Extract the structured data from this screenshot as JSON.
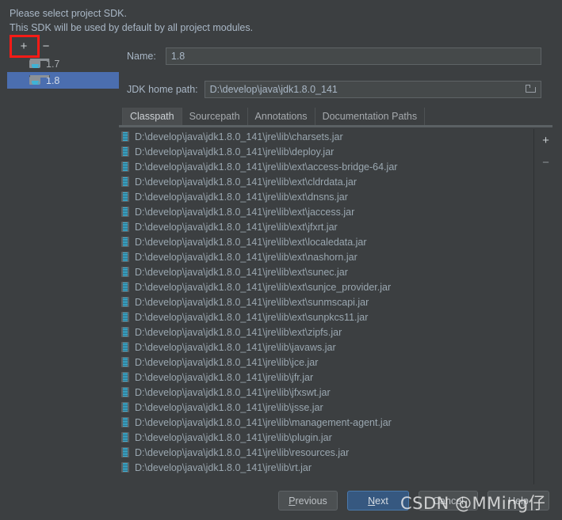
{
  "dialog": {
    "prompt_line1": "Please select project SDK.",
    "prompt_line2": "This SDK will be used by default by all project modules."
  },
  "sdk_panel": {
    "add_label": "+",
    "remove_label": "−",
    "items": [
      {
        "label": "1.7",
        "selected": false
      },
      {
        "label": "1.8",
        "selected": true
      }
    ]
  },
  "detail": {
    "name_label": "Name:",
    "name_value": "1.8",
    "path_label": "JDK home path:",
    "path_value": "D:\\develop\\java\\jdk1.8.0_141",
    "browse_icon": "folder-browse-icon"
  },
  "tabs": [
    {
      "label": "Classpath",
      "active": true
    },
    {
      "label": "Sourcepath",
      "active": false
    },
    {
      "label": "Annotations",
      "active": false
    },
    {
      "label": "Documentation Paths",
      "active": false
    }
  ],
  "classpath": {
    "add_label": "+",
    "remove_label": "−",
    "entries": [
      "D:\\develop\\java\\jdk1.8.0_141\\jre\\lib\\charsets.jar",
      "D:\\develop\\java\\jdk1.8.0_141\\jre\\lib\\deploy.jar",
      "D:\\develop\\java\\jdk1.8.0_141\\jre\\lib\\ext\\access-bridge-64.jar",
      "D:\\develop\\java\\jdk1.8.0_141\\jre\\lib\\ext\\cldrdata.jar",
      "D:\\develop\\java\\jdk1.8.0_141\\jre\\lib\\ext\\dnsns.jar",
      "D:\\develop\\java\\jdk1.8.0_141\\jre\\lib\\ext\\jaccess.jar",
      "D:\\develop\\java\\jdk1.8.0_141\\jre\\lib\\ext\\jfxrt.jar",
      "D:\\develop\\java\\jdk1.8.0_141\\jre\\lib\\ext\\localedata.jar",
      "D:\\develop\\java\\jdk1.8.0_141\\jre\\lib\\ext\\nashorn.jar",
      "D:\\develop\\java\\jdk1.8.0_141\\jre\\lib\\ext\\sunec.jar",
      "D:\\develop\\java\\jdk1.8.0_141\\jre\\lib\\ext\\sunjce_provider.jar",
      "D:\\develop\\java\\jdk1.8.0_141\\jre\\lib\\ext\\sunmscapi.jar",
      "D:\\develop\\java\\jdk1.8.0_141\\jre\\lib\\ext\\sunpkcs11.jar",
      "D:\\develop\\java\\jdk1.8.0_141\\jre\\lib\\ext\\zipfs.jar",
      "D:\\develop\\java\\jdk1.8.0_141\\jre\\lib\\javaws.jar",
      "D:\\develop\\java\\jdk1.8.0_141\\jre\\lib\\jce.jar",
      "D:\\develop\\java\\jdk1.8.0_141\\jre\\lib\\jfr.jar",
      "D:\\develop\\java\\jdk1.8.0_141\\jre\\lib\\jfxswt.jar",
      "D:\\develop\\java\\jdk1.8.0_141\\jre\\lib\\jsse.jar",
      "D:\\develop\\java\\jdk1.8.0_141\\jre\\lib\\management-agent.jar",
      "D:\\develop\\java\\jdk1.8.0_141\\jre\\lib\\plugin.jar",
      "D:\\develop\\java\\jdk1.8.0_141\\jre\\lib\\resources.jar",
      "D:\\develop\\java\\jdk1.8.0_141\\jre\\lib\\rt.jar"
    ]
  },
  "buttons": {
    "previous": {
      "mnemonic": "P",
      "rest": "revious"
    },
    "next": {
      "mnemonic": "N",
      "rest": "ext"
    },
    "cancel": "Cancel",
    "help": "Help"
  },
  "watermark": "CSDN @MMing仔",
  "colors": {
    "background": "#3c3f41",
    "selection_blue": "#4b6eaf",
    "primary_button": "#365880",
    "annotation_red": "#f71b16",
    "jar_icon_cyan": "#3fb3d6",
    "text": "#a9b7c6"
  }
}
